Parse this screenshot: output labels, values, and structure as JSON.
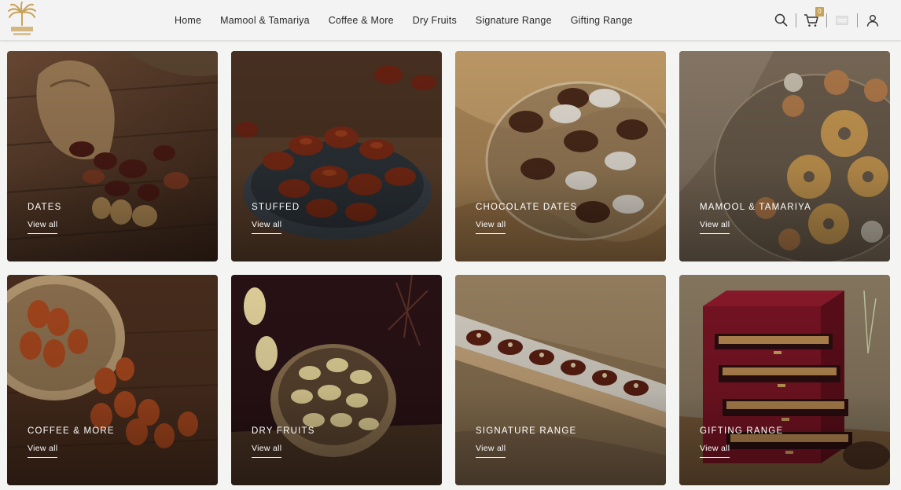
{
  "header": {
    "nav": [
      {
        "label": "Home"
      },
      {
        "label": "Mamool & Tamariya"
      },
      {
        "label": "Coffee & More"
      },
      {
        "label": "Dry Fruits"
      },
      {
        "label": "Signature Range"
      },
      {
        "label": "Gifting Range"
      }
    ],
    "cart_count": "0",
    "icons": [
      "search-icon",
      "cart-icon",
      "language-flag-icon",
      "user-icon"
    ]
  },
  "categories": [
    {
      "title": "DATES",
      "link": "View all"
    },
    {
      "title": "STUFFED",
      "link": "View all"
    },
    {
      "title": "CHOCOLATE DATES",
      "link": "View all"
    },
    {
      "title": "MAMOOL & TAMARIYA",
      "link": "View all"
    },
    {
      "title": "COFFEE & MORE",
      "link": "View all"
    },
    {
      "title": "DRY FRUITS",
      "link": "View all"
    },
    {
      "title": "SIGNATURE RANGE",
      "link": "View all"
    },
    {
      "title": "GIFTING RANGE",
      "link": "View all"
    }
  ],
  "colors": {
    "accent": "#c9a25a",
    "header_bg": "#f3f3f3",
    "text": "#2a2a2a"
  }
}
